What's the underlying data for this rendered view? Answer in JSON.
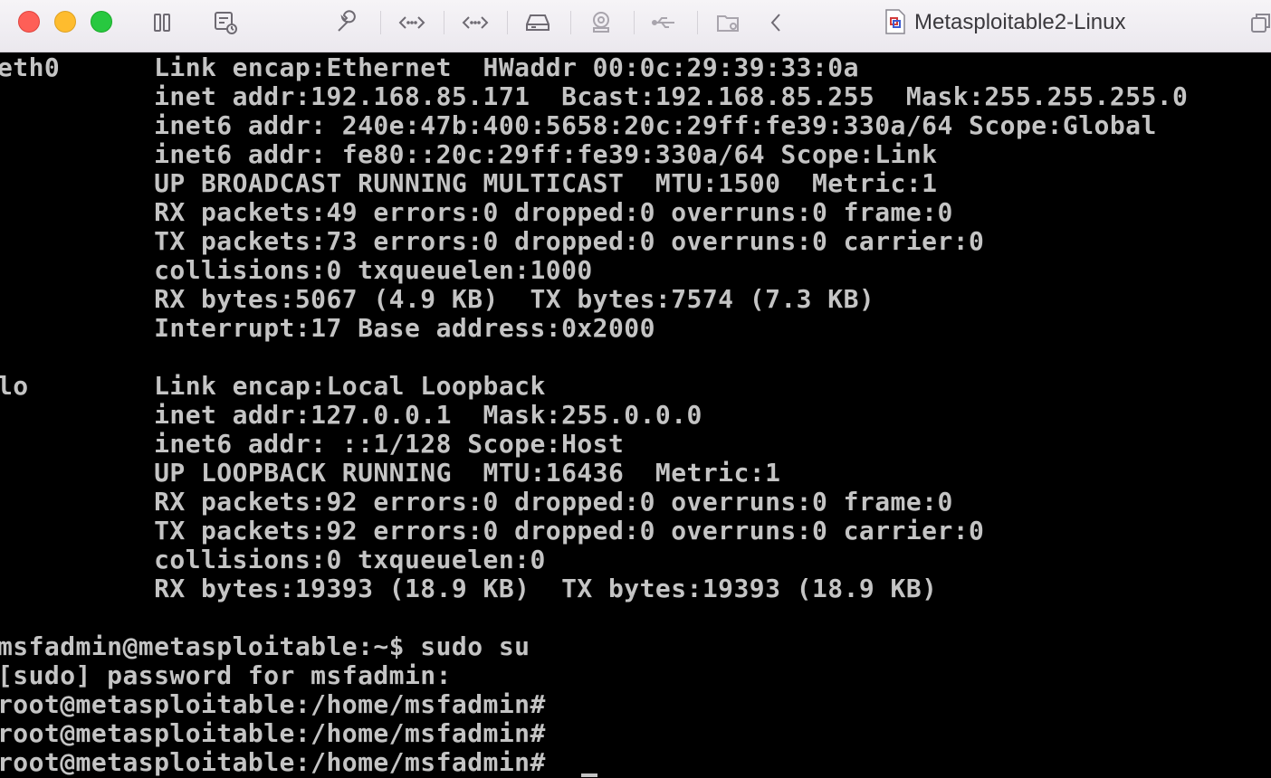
{
  "window": {
    "title": "Metasploitable2-Linux"
  },
  "toolbar": {
    "icons": [
      "sidebar-toggle-icon",
      "snapshot-icon",
      "settings-wrench-icon",
      "network-adapter-icon",
      "network-adapter-2-icon",
      "hard-disk-icon",
      "camera-icon",
      "usb-icon",
      "shared-folder-icon",
      "back-chevron-icon",
      "vm-file-icon",
      "window-restore-icon"
    ]
  },
  "terminal": {
    "lines": [
      "eth0      Link encap:Ethernet  HWaddr 00:0c:29:39:33:0a",
      "          inet addr:192.168.85.171  Bcast:192.168.85.255  Mask:255.255.255.0",
      "          inet6 addr: 240e:47b:400:5658:20c:29ff:fe39:330a/64 Scope:Global",
      "          inet6 addr: fe80::20c:29ff:fe39:330a/64 Scope:Link",
      "          UP BROADCAST RUNNING MULTICAST  MTU:1500  Metric:1",
      "          RX packets:49 errors:0 dropped:0 overruns:0 frame:0",
      "          TX packets:73 errors:0 dropped:0 overruns:0 carrier:0",
      "          collisions:0 txqueuelen:1000",
      "          RX bytes:5067 (4.9 KB)  TX bytes:7574 (7.3 KB)",
      "          Interrupt:17 Base address:0x2000",
      "",
      "lo        Link encap:Local Loopback",
      "          inet addr:127.0.0.1  Mask:255.0.0.0",
      "          inet6 addr: ::1/128 Scope:Host",
      "          UP LOOPBACK RUNNING  MTU:16436  Metric:1",
      "          RX packets:92 errors:0 dropped:0 overruns:0 frame:0",
      "          TX packets:92 errors:0 dropped:0 overruns:0 carrier:0",
      "          collisions:0 txqueuelen:0",
      "          RX bytes:19393 (18.9 KB)  TX bytes:19393 (18.9 KB)",
      "",
      "msfadmin@metasploitable:~$ sudo su",
      "[sudo] password for msfadmin:",
      "root@metasploitable:/home/msfadmin#",
      "root@metasploitable:/home/msfadmin#",
      "root@metasploitable:/home/msfadmin#"
    ]
  },
  "colors": {
    "terminal_bg": "#000000",
    "terminal_fg": "#c4c4c4",
    "toolbar_bg": "#f0eef2",
    "close": "#fe5f57",
    "minimize": "#febc2e",
    "maximize": "#28c840"
  }
}
